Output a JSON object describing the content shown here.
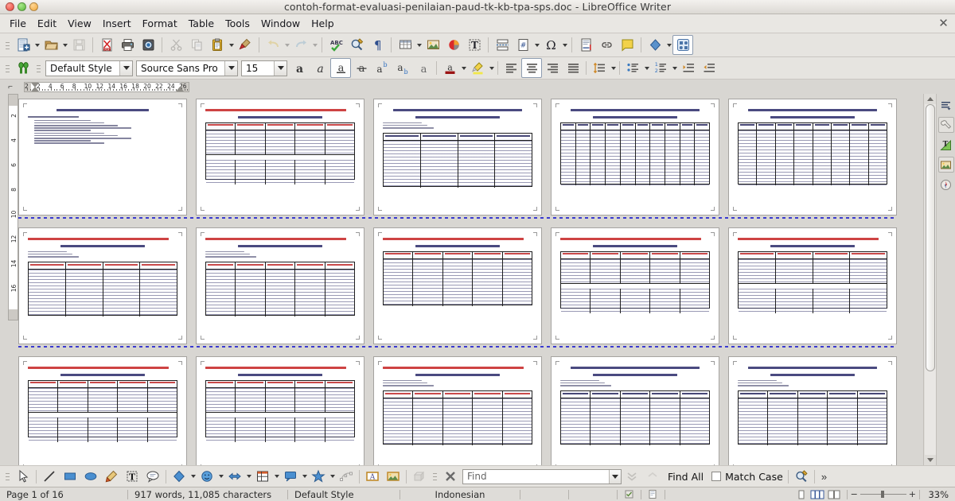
{
  "window": {
    "title": "contoh-format-evaluasi-penilaian-paud-tk-kb-tpa-sps.doc  -  LibreOffice Writer",
    "close_glyph": "✕"
  },
  "menubar": {
    "items": [
      {
        "label": "File",
        "name": "menu-file"
      },
      {
        "label": "Edit",
        "name": "menu-edit"
      },
      {
        "label": "View",
        "name": "menu-view"
      },
      {
        "label": "Insert",
        "name": "menu-insert"
      },
      {
        "label": "Format",
        "name": "menu-format"
      },
      {
        "label": "Table",
        "name": "menu-table"
      },
      {
        "label": "Tools",
        "name": "menu-tools"
      },
      {
        "label": "Window",
        "name": "menu-window"
      },
      {
        "label": "Help",
        "name": "menu-help"
      }
    ]
  },
  "standard_toolbar": {
    "buttons": [
      "new-document-icon",
      "open-document-icon",
      "save-document-icon",
      "export-pdf-icon",
      "print-icon",
      "print-preview-icon",
      "cut-icon",
      "copy-icon",
      "paste-icon",
      "clone-formatting-icon",
      "undo-icon",
      "redo-icon",
      "spelling-icon",
      "find-and-replace-icon",
      "formatting-marks-icon",
      "insert-table-icon",
      "insert-image-icon",
      "insert-chart-icon",
      "insert-text-box-icon",
      "insert-page-break-icon",
      "insert-field-icon",
      "insert-special-character-icon",
      "insert-footnote-icon",
      "insert-hyperlink-icon",
      "insert-comment-icon",
      "insert-shape-icon",
      "show-draw-functions-icon"
    ]
  },
  "formatting_toolbar": {
    "styles_icon": "paragraph-styles-icon",
    "paragraph_style": "Default Style",
    "font_name": "Source Sans Pro",
    "font_size": "15",
    "buttons": [
      "bold-icon",
      "italic-icon",
      "underline-icon",
      "strikethrough-icon",
      "superscript-icon",
      "subscript-icon",
      "clear-formatting-icon",
      "font-color-icon",
      "highlight-color-icon",
      "align-left-icon",
      "align-center-icon",
      "align-right-icon",
      "justified-icon",
      "unordered-list-icon",
      "ordered-list-icon",
      "increase-indent-icon",
      "decrease-indent-icon"
    ]
  },
  "ruler": {
    "tab_stop_icon": "tab-stop-left-icon",
    "horizontal_marks": [
      "2",
      "2",
      "4",
      "6",
      "8",
      "10",
      "12",
      "14",
      "16",
      "18",
      "20",
      "22",
      "24",
      "26"
    ],
    "vertical_marks": [
      "2",
      "4",
      "6",
      "8",
      "10",
      "12",
      "14",
      "16"
    ]
  },
  "document": {
    "zoom_mode": "multi-page-view",
    "page_rows": [
      {
        "pages": [
          {
            "name": "page-1",
            "kind": "outline",
            "title_color": "#2a2a6a",
            "header": "CONTOH FORMAT DAN INSTRUMEN PENILAIAN PAUD",
            "lines": 10
          },
          {
            "name": "page-2",
            "kind": "grid-table",
            "title_color": "#c62222",
            "header": "CONTOH FORMAT PENILAIAN HARIAN ANAK USIA DINI",
            "cols": 5,
            "blocks": 2
          },
          {
            "name": "page-3",
            "kind": "form-table",
            "title_color": "#2a2a6a",
            "header": "CATATAN ANEKDOT PERKEMBANGAN",
            "cols": 4,
            "rows": 4
          },
          {
            "name": "page-4",
            "kind": "checklist",
            "title_color": "#2a2a6a",
            "header": "SKALA CAPAIAN PERKEMBANGAN HARIAN",
            "cols": 10,
            "rows": 12
          },
          {
            "name": "page-5",
            "kind": "checklist",
            "title_color": "#2a2a6a",
            "header": "FORMAT PENILAIAN RANGKUMAN",
            "cols": 8,
            "rows": 10
          }
        ]
      },
      {
        "pages": [
          {
            "name": "page-6",
            "kind": "form-table",
            "title_color": "#c62222",
            "header": "CONTOH FORMAT PENILAIAN PERKEMBANGAN ANAK",
            "cols": 4,
            "rows": 4
          },
          {
            "name": "page-7",
            "kind": "numbered",
            "title_color": "#c62222",
            "header": "CONTOH FORMAT PENILAIAN KEMAMPUAN ANAK",
            "cols": 5,
            "rows": 9
          },
          {
            "name": "page-8",
            "kind": "section",
            "title_color": "#c62222",
            "header": "CONTOH FORMAT LAPORAN PERKEMBANGAN ANAK",
            "sections": 4
          },
          {
            "name": "page-9",
            "kind": "grid-table",
            "title_color": "#c62222",
            "header": "CONTOH FORMAT PENILAIAN BULANAN",
            "cols": 5,
            "rows": 8
          },
          {
            "name": "page-10",
            "kind": "grid-table",
            "title_color": "#c62222",
            "header": "CONTOH FORMAT PENILAIAN SEMESTER",
            "cols": 4,
            "rows": 8
          }
        ]
      },
      {
        "pages": [
          {
            "name": "page-11",
            "kind": "grid-table",
            "title_color": "#c62222",
            "header": "CONTOH FORMAT PENILAIAN MINGGUAN",
            "cols": 5,
            "rows": 8
          },
          {
            "name": "page-12",
            "kind": "grid-table",
            "title_color": "#c62222",
            "header": "CONTOH FORMAT PENILAIAN TAHUNAN",
            "cols": 5,
            "rows": 8
          },
          {
            "name": "page-13",
            "kind": "report",
            "title_color": "#c62222",
            "header": "LAPORAN PERKEMBANGAN ANAK DIDIK",
            "rows": 10
          },
          {
            "name": "page-14",
            "kind": "longform",
            "title_color": "#2a2a6a",
            "header": "FORMAT PENILAIAN HARIAN ANAK",
            "rows": 14
          },
          {
            "name": "page-15",
            "kind": "report",
            "title_color": "#2a2a6a",
            "header": "RAPOR PERKEMBANGAN ANAK",
            "rows": 9
          }
        ]
      }
    ]
  },
  "sidebar": {
    "items": [
      {
        "name": "sidebar-settings-icon",
        "label": "Sidebar Settings"
      },
      {
        "name": "properties-icon",
        "label": "Properties"
      },
      {
        "name": "styles-icon",
        "label": "Styles"
      },
      {
        "name": "gallery-icon",
        "label": "Gallery"
      },
      {
        "name": "navigator-icon",
        "label": "Navigator"
      }
    ]
  },
  "draw_toolbar": {
    "buttons": [
      "select-icon",
      "line-icon",
      "rectangle-icon",
      "ellipse-icon",
      "freeform-line-icon",
      "insert-text-box-icon",
      "callout-icon",
      "basic-shapes-icon",
      "symbol-shapes-icon",
      "block-arrows-icon",
      "flowchart-icon",
      "callout-shapes-icon",
      "stars-icon",
      "points-icon",
      "fontwork-icon",
      "from-file-icon",
      "extrusion-icon",
      "rotate-icon",
      "filter-icon"
    ]
  },
  "find_toolbar": {
    "close_icon": "close-find-toolbar-icon",
    "input_placeholder": "Find",
    "find_all_label": "Find All",
    "match_case_label": "Match Case",
    "find_replace_icon": "find-and-replace-icon",
    "overflow_label": "»",
    "find_value": ""
  },
  "statusbar": {
    "page_info": "Page 1 of 16",
    "word_count": "917 words, 11,085 characters",
    "page_style": "Default Style",
    "language": "Indonesian",
    "insert_mode": "",
    "selection_mode": "",
    "view_layout": "multi-page-view",
    "zoom_level": "33%"
  },
  "colors": {
    "chrome": "#e6e4e0",
    "window_bg": "#d8d6d2",
    "accent_red": "#c62222",
    "accent_blue": "#2a2a6a",
    "page_break": "#3a3ad0"
  }
}
